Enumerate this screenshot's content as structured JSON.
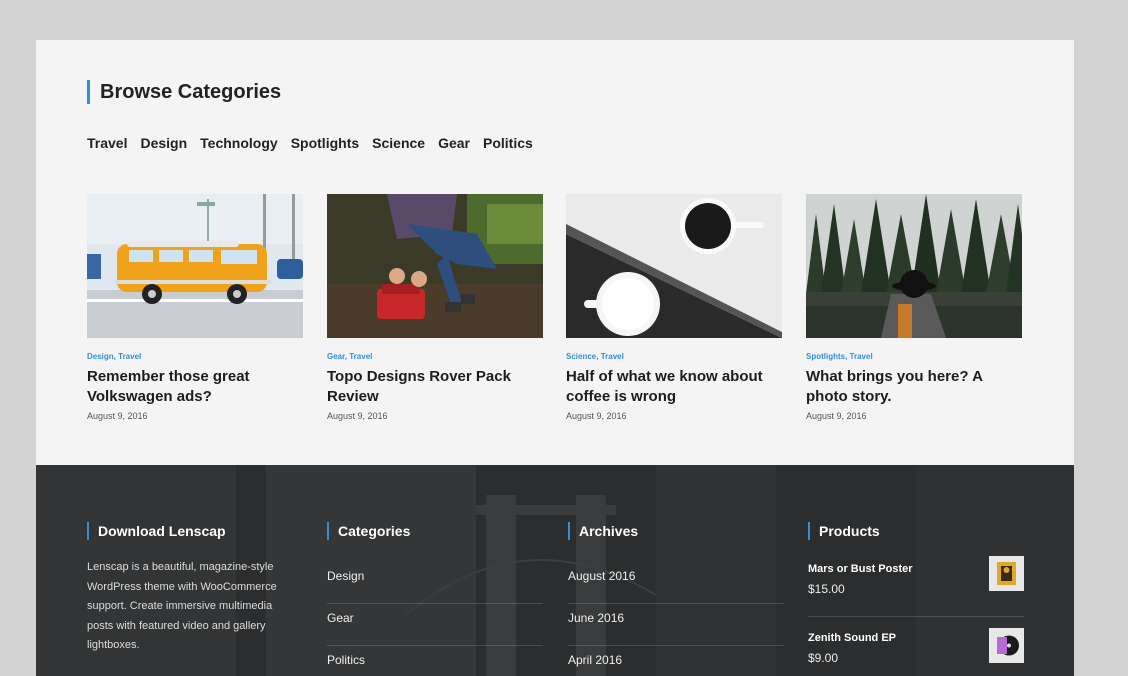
{
  "browse": {
    "title": "Browse Categories",
    "categories": [
      "Travel",
      "Design",
      "Technology",
      "Spotlights",
      "Science",
      "Gear",
      "Politics"
    ]
  },
  "posts": [
    {
      "cats": "Design, Travel",
      "title": "Remember those great Volkswagen ads?",
      "date": "August 9, 2016",
      "image": "yellow-van-photo"
    },
    {
      "cats": "Gear, Travel",
      "title": "Topo Designs Rover Pack Review",
      "date": "August 9, 2016",
      "image": "hiker-backpack-photo"
    },
    {
      "cats": "Science, Travel",
      "title": "Half of what we know about coffee is wrong",
      "date": "August 9, 2016",
      "image": "coffee-cups-photo"
    },
    {
      "cats": "Spotlights, Travel",
      "title": "What brings you here? A photo story.",
      "date": "August 9, 2016",
      "image": "forest-lake-photo"
    }
  ],
  "footer": {
    "about": {
      "heading": "Download Lenscap",
      "text": "Lenscap is a beautiful, magazine-style WordPress theme with WooCommerce support. Create immersive multimedia posts with featured video and gallery lightboxes."
    },
    "categories": {
      "heading": "Categories",
      "items": [
        "Design",
        "Gear",
        "Politics"
      ]
    },
    "archives": {
      "heading": "Archives",
      "items": [
        "August 2016",
        "June 2016",
        "April 2016"
      ]
    },
    "products": {
      "heading": "Products",
      "items": [
        {
          "name": "Mars or Bust Poster",
          "price": "$15.00",
          "icon": "poster-thumbnail"
        },
        {
          "name": "Zenith Sound EP",
          "price": "$9.00",
          "icon": "vinyl-record-thumbnail"
        }
      ]
    }
  },
  "colors": {
    "accent": "#2f8fdd",
    "footer_bg": "#2c2d2e",
    "page_bg": "#f4f4f4"
  }
}
